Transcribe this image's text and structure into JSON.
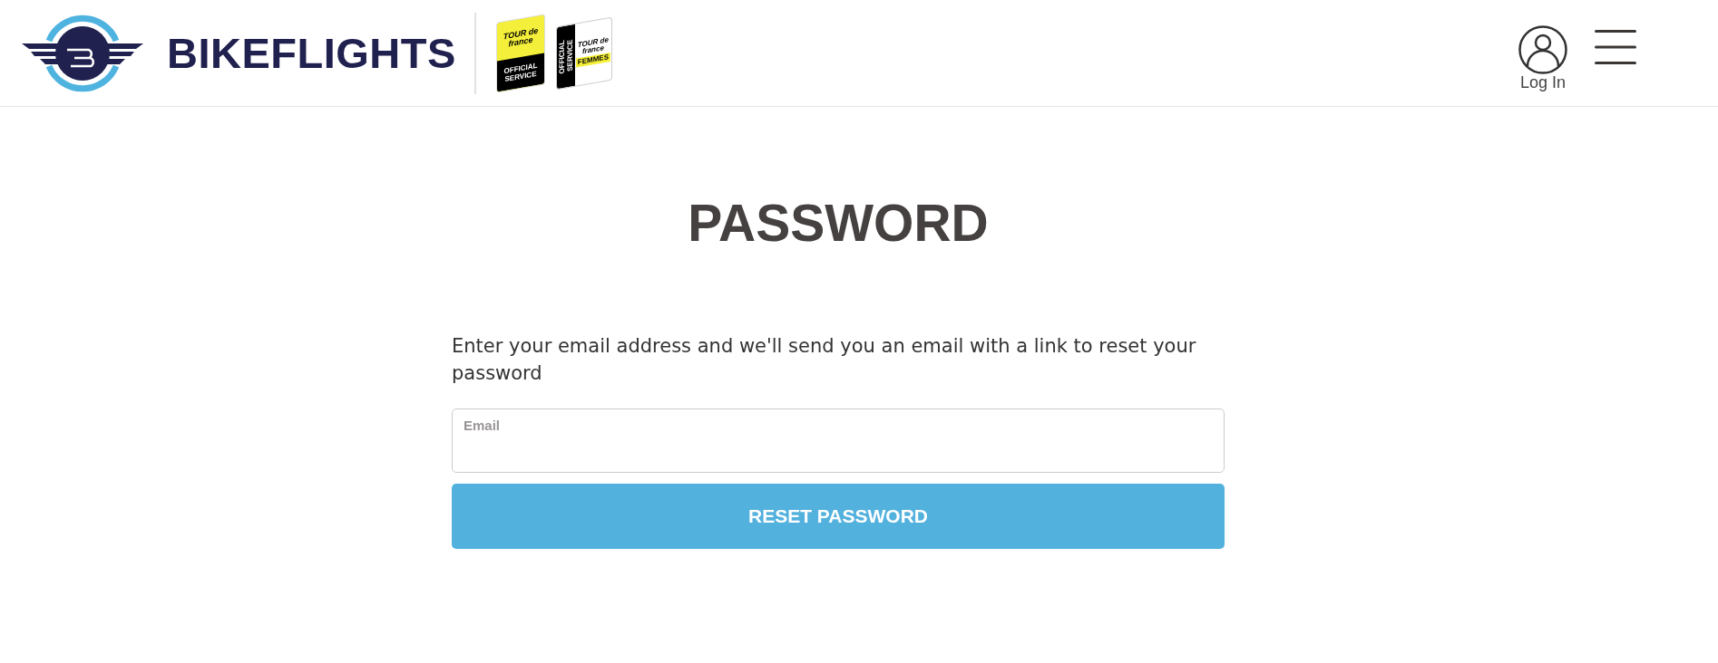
{
  "header": {
    "brand": {
      "name": "BIKEFLIGHTS"
    },
    "partner_badges": [
      {
        "kind": "official",
        "wordmark": "TOUR de france",
        "service": "OFFICIAL SERVICE"
      },
      {
        "kind": "femmes",
        "wordmark": "TOUR de france",
        "service": "OFFICIAL SERVICE",
        "edition": "FEMMES"
      }
    ],
    "login": {
      "label": "Log In"
    }
  },
  "page": {
    "title": "PASSWORD",
    "instructions": "Enter your email address and we'll send you an email with a link to reset your password",
    "email_field": {
      "label": "Email"
    },
    "submit_button": {
      "label": "RESET PASSWORD"
    }
  }
}
